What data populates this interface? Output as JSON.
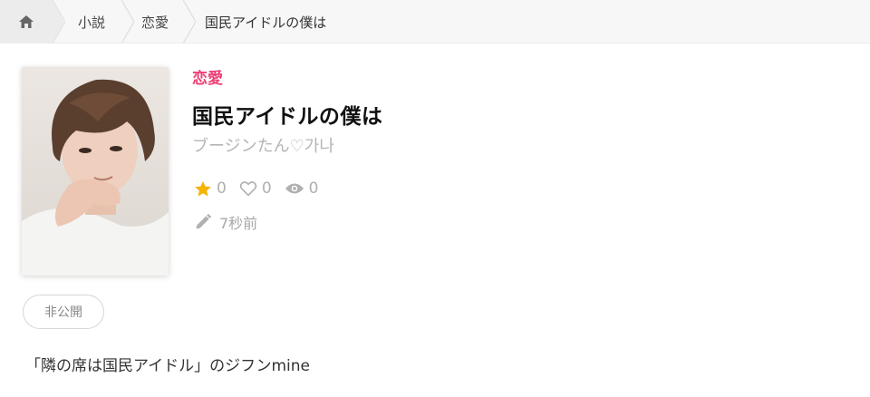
{
  "breadcrumb": {
    "home_icon": "home-icon",
    "items": [
      "小説",
      "恋愛",
      "国民アイドルの僕は"
    ]
  },
  "book": {
    "genre": "恋愛",
    "title": "国民アイドルの僕は",
    "author": "ブージンたん♡가나",
    "stats": {
      "stars": "0",
      "likes": "0",
      "views": "0"
    },
    "updated": "7秒前",
    "visibility_tag": "非公開",
    "description": "「隣の席は国民アイドル」のジフンmine"
  },
  "colors": {
    "genre": "#ee3f74",
    "star": "#f5b400",
    "muted": "#b0b0b0"
  }
}
